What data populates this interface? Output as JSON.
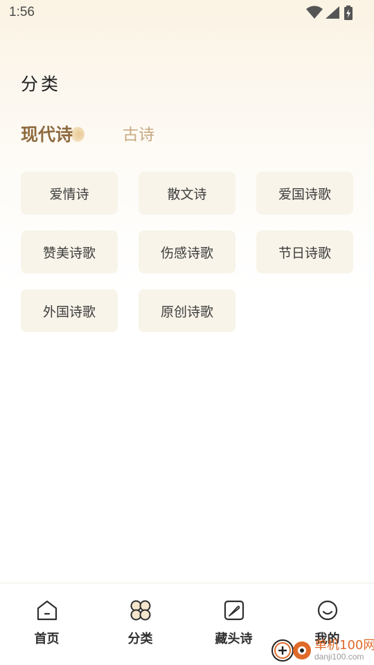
{
  "status_bar": {
    "time": "1:56",
    "icons": [
      "wifi-icon",
      "signal-icon",
      "battery-icon"
    ]
  },
  "page": {
    "title": "分类"
  },
  "tabs": [
    {
      "label": "现代诗",
      "active": true
    },
    {
      "label": "古诗",
      "active": false
    }
  ],
  "categories": [
    "爱情诗",
    "散文诗",
    "爱国诗歌",
    "赞美诗歌",
    "伤感诗歌",
    "节日诗歌",
    "外国诗歌",
    "原创诗歌"
  ],
  "bottom_nav": [
    {
      "label": "首页",
      "icon": "home-icon"
    },
    {
      "label": "分类",
      "icon": "category-icon"
    },
    {
      "label": "藏头诗",
      "icon": "feather-icon"
    },
    {
      "label": "我的",
      "icon": "smiley-icon"
    }
  ],
  "watermark": {
    "brand": "单机100网",
    "url": "danji100.com"
  },
  "colors": {
    "accent": "#8e6a3f",
    "tab_inactive": "#c7a983",
    "chip_bg": "#f8f4e9",
    "watermark": "#e06a2a"
  }
}
